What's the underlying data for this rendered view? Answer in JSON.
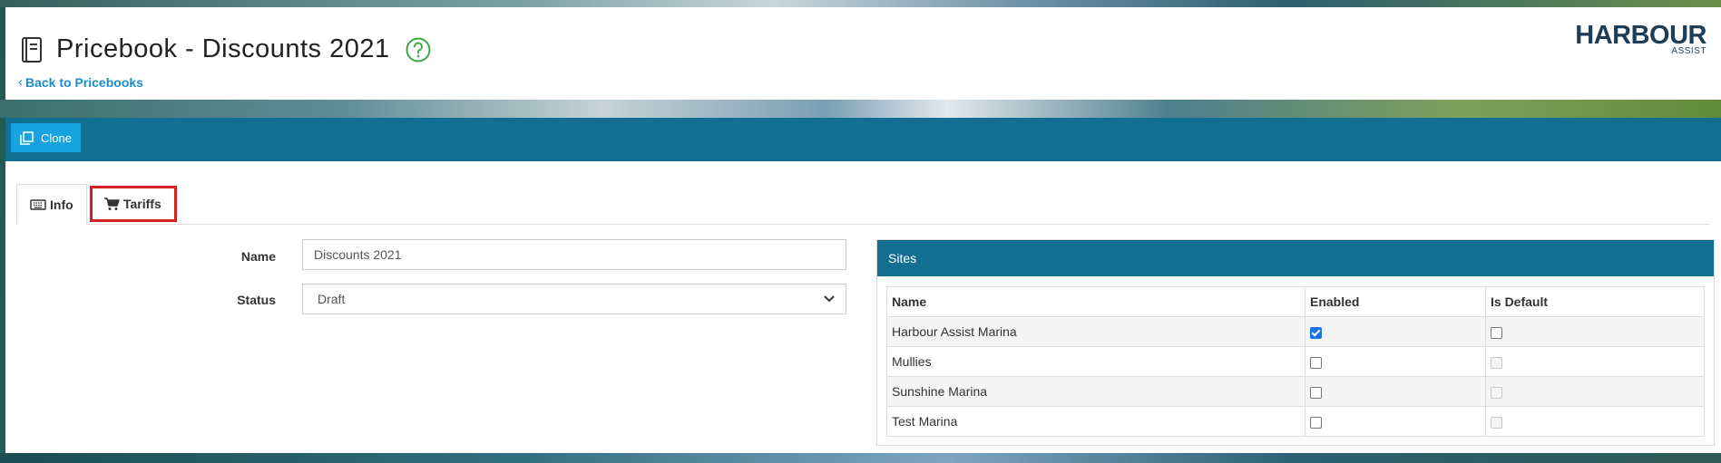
{
  "header": {
    "title": "Pricebook - Discounts 2021",
    "back_link": "Back to Pricebooks",
    "logo_main": "HARBOUR",
    "logo_sub": "ASSIST"
  },
  "toolbar": {
    "clone_label": "Clone"
  },
  "tabs": [
    {
      "label": "Info",
      "icon": "keyboard-icon",
      "active": true
    },
    {
      "label": "Tariffs",
      "icon": "cart-icon",
      "active": false,
      "highlighted": true
    }
  ],
  "form": {
    "name_label": "Name",
    "name_value": "Discounts 2021",
    "status_label": "Status",
    "status_value": "Draft"
  },
  "sites": {
    "title": "Sites",
    "columns": [
      "Name",
      "Enabled",
      "Is Default"
    ],
    "rows": [
      {
        "name": "Harbour Assist Marina",
        "enabled": true,
        "is_default": false,
        "default_disabled": false
      },
      {
        "name": "Mullies",
        "enabled": false,
        "is_default": false,
        "default_disabled": true
      },
      {
        "name": "Sunshine Marina",
        "enabled": false,
        "is_default": false,
        "default_disabled": true
      },
      {
        "name": "Test Marina",
        "enabled": false,
        "is_default": false,
        "default_disabled": true
      }
    ]
  },
  "colors": {
    "brand_blue": "#136f92",
    "button_blue": "#16a3df",
    "link_blue": "#1a8cc9",
    "help_green": "#3aa845",
    "highlight_red": "#d52020"
  }
}
